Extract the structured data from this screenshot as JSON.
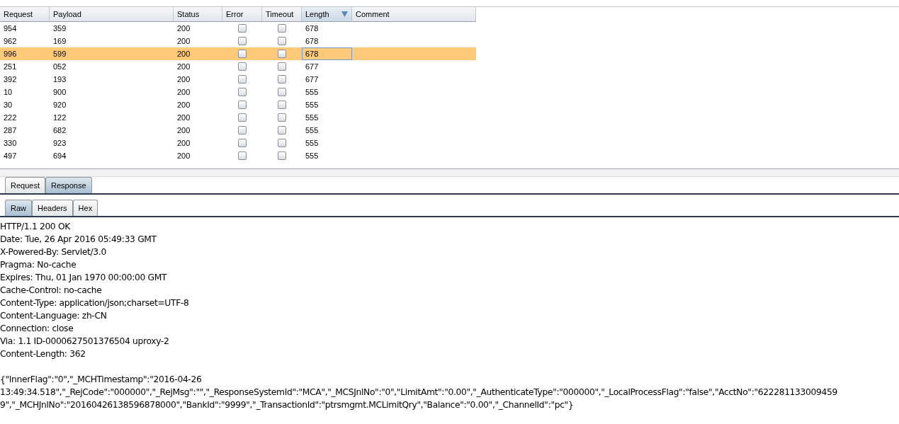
{
  "table": {
    "columns": [
      {
        "label": "Request",
        "sorted": false
      },
      {
        "label": "Payload",
        "sorted": false
      },
      {
        "label": "Status",
        "sorted": false
      },
      {
        "label": "Error",
        "sorted": false
      },
      {
        "label": "Timeout",
        "sorted": false
      },
      {
        "label": "Length",
        "sorted": true
      },
      {
        "label": "Comment",
        "sorted": false
      }
    ],
    "rows": [
      {
        "request": "954",
        "payload": "359",
        "status": "200",
        "error": false,
        "timeout": false,
        "length": "678",
        "selected": false
      },
      {
        "request": "962",
        "payload": "169",
        "status": "200",
        "error": false,
        "timeout": false,
        "length": "678",
        "selected": false
      },
      {
        "request": "996",
        "payload": "599",
        "status": "200",
        "error": false,
        "timeout": false,
        "length": "678",
        "selected": true
      },
      {
        "request": "251",
        "payload": "052",
        "status": "200",
        "error": false,
        "timeout": false,
        "length": "677",
        "selected": false
      },
      {
        "request": "392",
        "payload": "193",
        "status": "200",
        "error": false,
        "timeout": false,
        "length": "677",
        "selected": false
      },
      {
        "request": "10",
        "payload": "900",
        "status": "200",
        "error": false,
        "timeout": false,
        "length": "555",
        "selected": false
      },
      {
        "request": "30",
        "payload": "920",
        "status": "200",
        "error": false,
        "timeout": false,
        "length": "555",
        "selected": false
      },
      {
        "request": "222",
        "payload": "122",
        "status": "200",
        "error": false,
        "timeout": false,
        "length": "555",
        "selected": false
      },
      {
        "request": "287",
        "payload": "682",
        "status": "200",
        "error": false,
        "timeout": false,
        "length": "555",
        "selected": false
      },
      {
        "request": "330",
        "payload": "923",
        "status": "200",
        "error": false,
        "timeout": false,
        "length": "555",
        "selected": false
      },
      {
        "request": "497",
        "payload": "694",
        "status": "200",
        "error": false,
        "timeout": false,
        "length": "555",
        "selected": false
      }
    ]
  },
  "tabs": [
    {
      "label": "Request",
      "selected": false
    },
    {
      "label": "Response",
      "selected": true
    }
  ],
  "view_tabs": [
    {
      "label": "Raw",
      "selected": true
    },
    {
      "label": "Headers",
      "selected": false
    },
    {
      "label": "Hex",
      "selected": false
    }
  ],
  "response_lines": [
    "HTTP/1.1 200 OK",
    "Date: Tue, 26 Apr 2016 05:49:33 GMT",
    "X-Powered-By: Servlet/3.0",
    "Pragma: No-cache",
    "Expires: Thu, 01 Jan 1970 00:00:00 GMT",
    "Cache-Control: no-cache",
    "Content-Type: application/json;charset=UTF-8",
    "Content-Language: zh-CN",
    "Connection: close",
    "Via: 1.1 ID-0000627501376504 uproxy-2",
    "Content-Length: 362"
  ],
  "response_body_lines": [
    "{\"InnerFlag\":\"0\",\"_MCHTimestamp\":\"2016-04-26",
    "13:49:34.518\",\"_RejCode\":\"000000\",\"_RejMsg\":\"\",\"_ResponseSystemId\":\"MCA\",\"_MCSJnlNo\":\"0\",\"LimitAmt\":\"0.00\",\"_AuthenticateType\":\"000000\",\"_LocalProcessFlag\":\"false\",\"AcctNo\":\"622281133009459",
    "9\",\"_MCHJnlNo\":\"20160426138596878000\",\"BankId\":\"9999\",\"_TransactionId\":\"ptrsmgmt.MCLimitQry\",\"Balance\":\"0.00\",\"_ChannelId\":\"pc\"}"
  ]
}
